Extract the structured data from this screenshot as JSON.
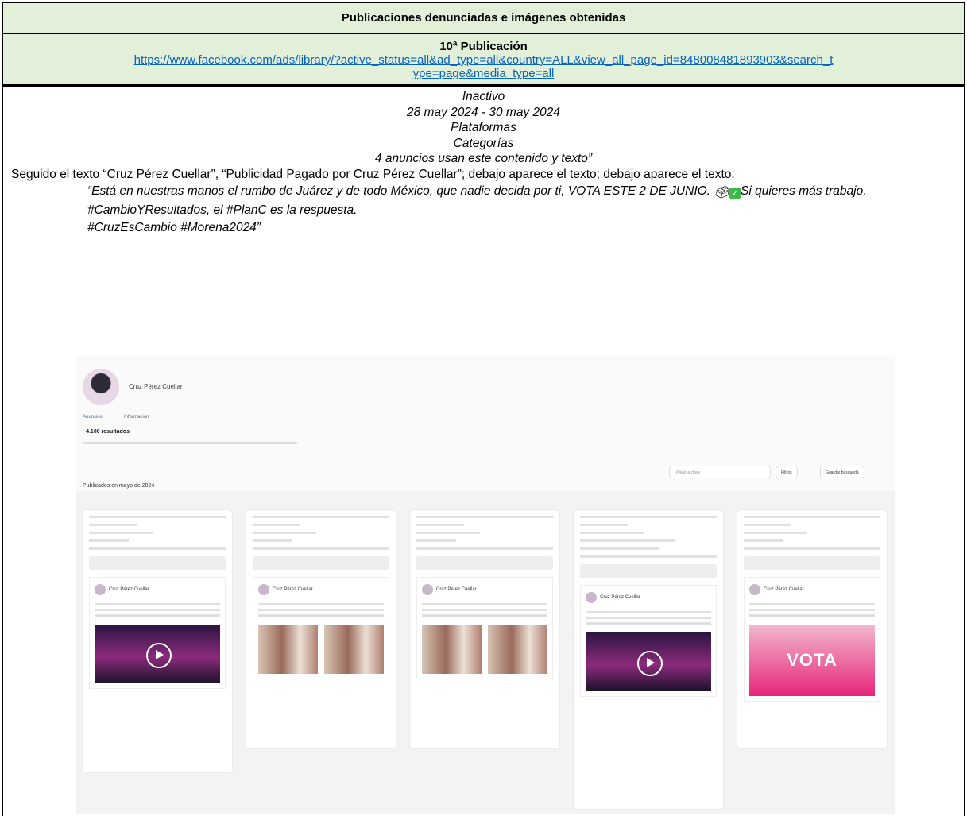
{
  "header": {
    "title": "Publicaciones denunciadas e imágenes obtenidas"
  },
  "publication": {
    "number": "10ª Publicación",
    "url_line1": "https://www.facebook.com/ads/library/?active_status=all&ad_type=all&country=ALL&view_all_page_id=848008481893903&search_t",
    "url_line2": "ype=page&media_type=all"
  },
  "meta": {
    "status": "Inactivo",
    "dates": "28 may 2024 - 30 may 2024",
    "platforms": "Plataformas",
    "categories": "Categorías",
    "ads_count": "4 anuncios usan este contenido y texto”"
  },
  "description": "Seguido el texto “Cruz Pérez Cuellar”, “Publicidad Pagado por Cruz Pérez Cuellar”; debajo aparece el texto; debajo aparece el texto:",
  "quote": {
    "part1": "“Está en nuestras manos el rumbo de Juárez y de todo México, que nadie decida por ti, VOTA ESTE 2 DE JUNIO. ",
    "emoji1": "🗳",
    "emoji2": "✓",
    "part2": "Si quieres más trabajo, #CambioYResultados, el #PlanC es la respuesta.",
    "line3": "#CruzEsCambio #Morena2024”"
  },
  "screenshot": {
    "page_name": "Cruz Pérez Cuellar",
    "tab_ads": "Anuncios",
    "tab_about": "Información",
    "results": "~4.100 resultados",
    "search_placeholder": "Palabra clave",
    "filter_label": "Filtros",
    "save_label": "Guardar búsqueda",
    "published_in": "Publicados en mayo de 2024",
    "card_names": [
      "Cruz Pérez Cuellar",
      "Cruz Pérez Cuellar",
      "Cruz Pérez Cuellar",
      "Cruz Pérez Cuellar",
      "Cruz Pérez Cuellar"
    ],
    "poster_text": "VOTA"
  }
}
